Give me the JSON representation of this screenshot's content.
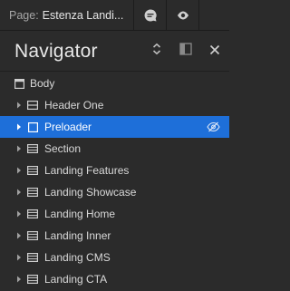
{
  "topbar": {
    "page_prefix": "Page:",
    "page_name": "Estenza Landi...",
    "icons": [
      "comment-icon",
      "preview-eye-icon"
    ]
  },
  "navigator": {
    "title": "Navigator",
    "header_icons": [
      "expand-collapse-icon",
      "dock-panel-icon",
      "close-icon"
    ]
  },
  "tree": {
    "root": {
      "label": "Body",
      "icon": "page-icon"
    },
    "items": [
      {
        "label": "Header One",
        "icon": "symbol-icon",
        "selected": false
      },
      {
        "label": "Preloader",
        "icon": "div-block-icon",
        "selected": true,
        "hidden_icon": "eye-slash-icon"
      },
      {
        "label": "Section",
        "icon": "section-icon",
        "selected": false
      },
      {
        "label": "Landing Features",
        "icon": "section-icon",
        "selected": false
      },
      {
        "label": "Landing Showcase",
        "icon": "section-icon",
        "selected": false
      },
      {
        "label": "Landing Home",
        "icon": "section-icon",
        "selected": false
      },
      {
        "label": "Landing Inner",
        "icon": "section-icon",
        "selected": false
      },
      {
        "label": "Landing CMS",
        "icon": "section-icon",
        "selected": false
      },
      {
        "label": "Landing CTA",
        "icon": "section-icon",
        "selected": false
      }
    ]
  },
  "colors": {
    "background": "#2b2b2b",
    "selected_row": "#1e6fd9",
    "text": "#d9d9d9"
  }
}
